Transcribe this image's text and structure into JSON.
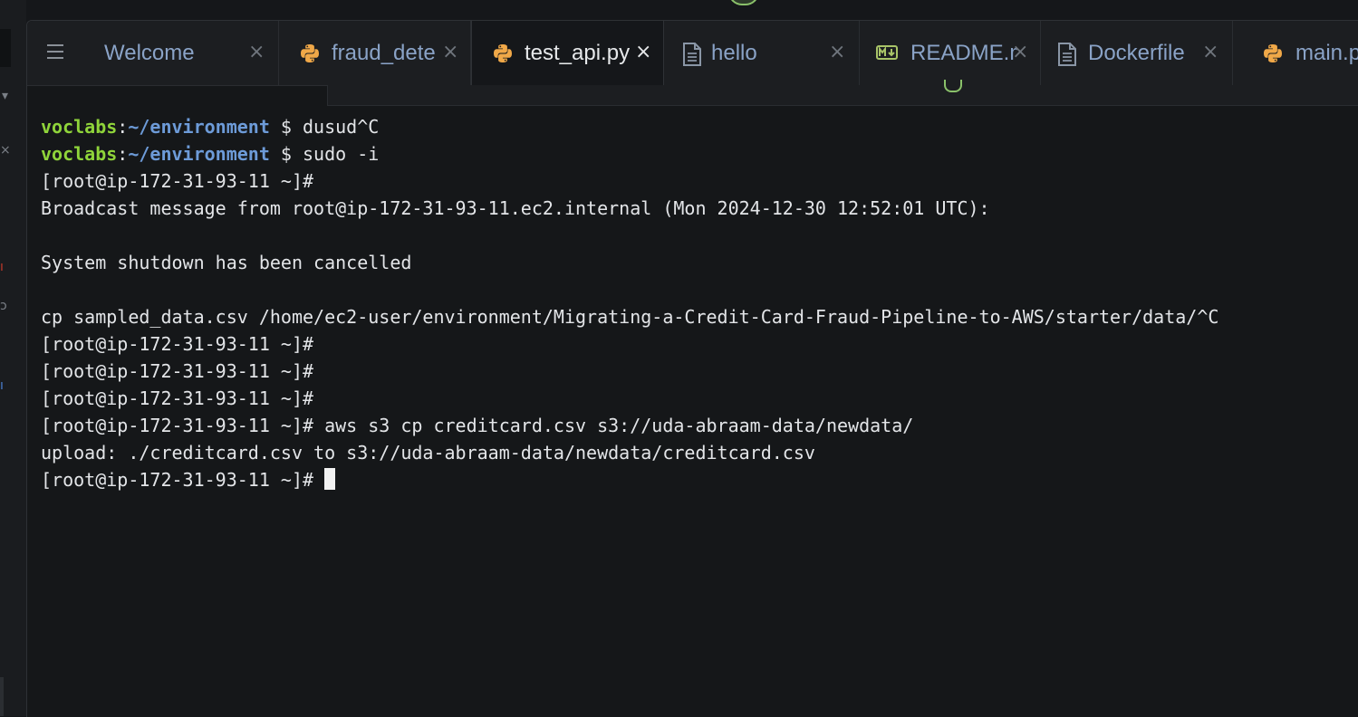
{
  "tabs": [
    {
      "label": "Welcome",
      "icon": "none",
      "active": false
    },
    {
      "label": "fraud_dete",
      "icon": "python-icon",
      "active": false
    },
    {
      "label": "test_api.py",
      "icon": "python-icon",
      "active": true
    },
    {
      "label": "hello",
      "icon": "file-icon",
      "active": false
    },
    {
      "label": "README.m",
      "icon": "markdown-icon",
      "active": false
    },
    {
      "label": "Dockerfile",
      "icon": "file-icon",
      "active": false
    },
    {
      "label": "main.p",
      "icon": "python-icon",
      "active": false
    }
  ],
  "terminal": {
    "lines": {
      "l0": {
        "user": "voclabs",
        "colon": ":",
        "path": "~/environment",
        "rest": " $ dusud^C"
      },
      "l1": {
        "user": "voclabs",
        "colon": ":",
        "path": "~/environment",
        "rest": " $ sudo -i"
      },
      "l2": "[root@ip-172-31-93-11 ~]#",
      "l3": "Broadcast message from root@ip-172-31-93-11.ec2.internal (Mon 2024-12-30 12:52:01 UTC):",
      "l4": "",
      "l5": "System shutdown has been cancelled",
      "l6": "",
      "l7": "cp sampled_data.csv /home/ec2-user/environment/Migrating-a-Credit-Card-Fraud-Pipeline-to-AWS/starter/data/^C",
      "l8": "[root@ip-172-31-93-11 ~]#",
      "l9": "[root@ip-172-31-93-11 ~]#",
      "l10": "[root@ip-172-31-93-11 ~]#",
      "l11": "[root@ip-172-31-93-11 ~]# aws s3 cp creditcard.csv s3://uda-abraam-data/newdata/",
      "l12": "upload: ./creditcard.csv to s3://uda-abraam-data/newdata/creditcard.csv",
      "l13": "[root@ip-172-31-93-11 ~]# "
    }
  },
  "colors": {
    "prompt_user": "#8fd43a",
    "prompt_path": "#6d9bd8",
    "terminal_bg": "#15171a",
    "tab_label": "#8aa3c7"
  }
}
